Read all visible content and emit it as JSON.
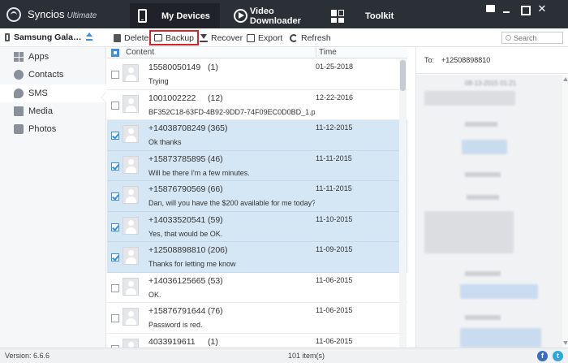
{
  "app": {
    "name": "Syncios",
    "edition": "Ultimate"
  },
  "nav": {
    "tabs": [
      {
        "label": "My Devices"
      },
      {
        "label": "Video Downloader"
      },
      {
        "label": "Toolkit"
      }
    ]
  },
  "device": {
    "name": "Samsung Galaxy Z..."
  },
  "sidebar": {
    "items": [
      {
        "label": "Apps",
        "icon": "apps-icon"
      },
      {
        "label": "Contacts",
        "icon": "contacts-icon"
      },
      {
        "label": "SMS",
        "icon": "sms-icon"
      },
      {
        "label": "Media",
        "icon": "media-icon"
      },
      {
        "label": "Photos",
        "icon": "photos-icon"
      }
    ],
    "active": "SMS"
  },
  "toolbar": {
    "delete_label": "Delete",
    "backup_label": "Backup",
    "recover_label": "Recover",
    "export_label": "Export",
    "refresh_label": "Refresh",
    "search_placeholder": "Search",
    "highlight_color": "#d9232b"
  },
  "list": {
    "columns": {
      "content": "Content",
      "time": "Time"
    },
    "rows": [
      {
        "number": "15580050149",
        "count": "(1)",
        "preview": "Trying",
        "date": "01-25-2018",
        "selected": false
      },
      {
        "number": "1001002222",
        "count": "(12)",
        "preview": "BF352C18-63FD-4B92-9DD7-74F09EC0D0BD_1.png",
        "date": "12-22-2016",
        "selected": false
      },
      {
        "number": "+14038708249",
        "count": "(365)",
        "preview": "Ok thanks",
        "date": "11-12-2015",
        "selected": true
      },
      {
        "number": "+15873785895",
        "count": "(46)",
        "preview": "Will be there I'm a few minutes.",
        "date": "11-11-2015",
        "selected": true
      },
      {
        "number": "+15876790569",
        "count": "(66)",
        "preview": "Dan, will you have the $200 available for me today?",
        "date": "11-11-2015",
        "selected": true
      },
      {
        "number": "+14033520541",
        "count": "(59)",
        "preview": "Yes, that would be OK.",
        "date": "11-10-2015",
        "selected": true
      },
      {
        "number": "+12508898810",
        "count": "(206)",
        "preview": "Thanks for letting me know",
        "date": "11-09-2015",
        "selected": true
      },
      {
        "number": "+14036125665",
        "count": "(53)",
        "preview": "OK.",
        "date": "11-06-2015",
        "selected": false
      },
      {
        "number": "+15876791644",
        "count": "(76)",
        "preview": "Password is red.",
        "date": "11-06-2015",
        "selected": false
      },
      {
        "number": "4033919611",
        "count": "(1)",
        "preview": "",
        "date": "11-06-2015",
        "selected": false
      }
    ]
  },
  "conversation": {
    "to_label": "To:",
    "number": "+12508898810",
    "first_date": "08-13-2015 01:21"
  },
  "status": {
    "version": "Version: 6.6.6",
    "items": "101 item(s)"
  },
  "colors": {
    "titlebar": "#2b2f36",
    "selection": "#d5e6f4",
    "accent": "#3a8ee6"
  }
}
